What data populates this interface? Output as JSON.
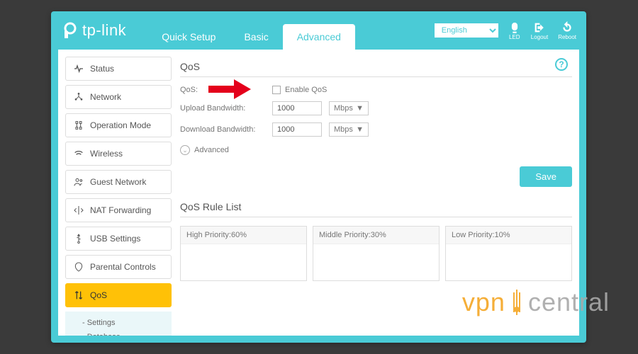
{
  "brand": "tp-link",
  "tabs": {
    "quick": "Quick Setup",
    "basic": "Basic",
    "advanced": "Advanced"
  },
  "language": "English",
  "top_icons": {
    "led": "LED",
    "logout": "Logout",
    "reboot": "Reboot"
  },
  "sidebar": {
    "status": "Status",
    "network": "Network",
    "opmode": "Operation Mode",
    "wireless": "Wireless",
    "guest": "Guest Network",
    "nat": "NAT Forwarding",
    "usb": "USB Settings",
    "parental": "Parental Controls",
    "qos": "QoS",
    "sub": {
      "settings": "Settings",
      "database": "Database"
    }
  },
  "main": {
    "title": "QoS",
    "qos_label": "QoS:",
    "enable_label": "Enable QoS",
    "upload_label": "Upload Bandwidth:",
    "download_label": "Download Bandwidth:",
    "upload_value": "1000",
    "download_value": "1000",
    "unit": "Mbps",
    "advanced_toggle": "Advanced",
    "save": "Save",
    "rule_title": "QoS Rule List",
    "rules": {
      "high": "High Priority:60%",
      "mid": "Middle Priority:30%",
      "low": "Low Priority:10%"
    }
  },
  "watermark": {
    "left": "vpn",
    "right": "central"
  }
}
